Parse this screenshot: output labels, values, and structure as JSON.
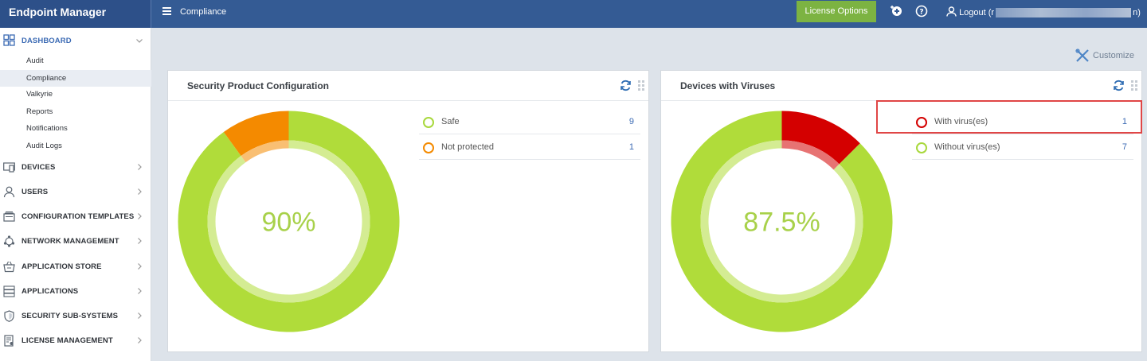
{
  "app": {
    "title": "Endpoint Manager"
  },
  "header": {
    "breadcrumb": "Compliance",
    "license_button": "License Options",
    "logout_prefix": "Logout (r",
    "logout_suffix": "n)"
  },
  "sidebar": {
    "dashboard": {
      "label": "DASHBOARD",
      "subitems": [
        "Audit",
        "Compliance",
        "Valkyrie",
        "Reports",
        "Notifications",
        "Audit Logs"
      ],
      "active": "Compliance"
    },
    "items": [
      {
        "label": "DEVICES",
        "icon": "devices-icon"
      },
      {
        "label": "USERS",
        "icon": "user-icon"
      },
      {
        "label": "CONFIGURATION TEMPLATES",
        "icon": "template-icon"
      },
      {
        "label": "NETWORK MANAGEMENT",
        "icon": "network-icon"
      },
      {
        "label": "APPLICATION STORE",
        "icon": "store-icon"
      },
      {
        "label": "APPLICATIONS",
        "icon": "applications-icon"
      },
      {
        "label": "SECURITY SUB-SYSTEMS",
        "icon": "shield-icon"
      },
      {
        "label": "LICENSE MANAGEMENT",
        "icon": "license-icon"
      }
    ]
  },
  "toolbar": {
    "customize_label": "Customize"
  },
  "widgets": [
    {
      "title": "Security Product Configuration",
      "center_text": "90%",
      "legend": [
        {
          "label": "Safe",
          "count": "9",
          "color": "#a8d83c"
        },
        {
          "label": "Not protected",
          "count": "1",
          "color": "#f48a00"
        }
      ]
    },
    {
      "title": "Devices with Viruses",
      "center_text": "87.5%",
      "legend": [
        {
          "label": "With virus(es)",
          "count": "1",
          "color": "#d40000"
        },
        {
          "label": "Without virus(es)",
          "count": "7",
          "color": "#a8d83c"
        }
      ]
    }
  ],
  "chart_data": [
    {
      "type": "pie",
      "title": "Security Product Configuration",
      "categories": [
        "Safe",
        "Not protected"
      ],
      "values": [
        9,
        1
      ],
      "colors": [
        "#b0dc3a",
        "#f48a00"
      ]
    },
    {
      "type": "pie",
      "title": "Devices with Viruses",
      "categories": [
        "With virus(es)",
        "Without virus(es)"
      ],
      "values": [
        1,
        7
      ],
      "colors": [
        "#d40000",
        "#b0dc3a"
      ]
    }
  ]
}
